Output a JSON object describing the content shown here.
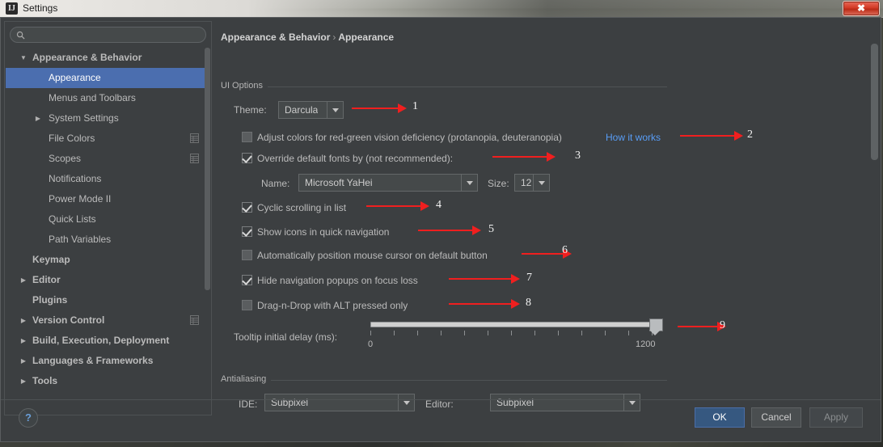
{
  "window": {
    "title": "Settings",
    "app_icon": "intellij-idea-icon",
    "close_label": "✖"
  },
  "sidebar": {
    "search": {
      "value": "",
      "placeholder": ""
    },
    "items": [
      {
        "label": "Appearance & Behavior",
        "level": 0,
        "arrow": "down",
        "selected": false,
        "gear": false
      },
      {
        "label": "Appearance",
        "level": 1,
        "arrow": "none",
        "selected": true,
        "gear": false
      },
      {
        "label": "Menus and Toolbars",
        "level": 1,
        "arrow": "none",
        "selected": false,
        "gear": false
      },
      {
        "label": "System Settings",
        "level": 1,
        "arrow": "right",
        "selected": false,
        "gear": false
      },
      {
        "label": "File Colors",
        "level": 1,
        "arrow": "none",
        "selected": false,
        "gear": true
      },
      {
        "label": "Scopes",
        "level": 1,
        "arrow": "none",
        "selected": false,
        "gear": true
      },
      {
        "label": "Notifications",
        "level": 1,
        "arrow": "none",
        "selected": false,
        "gear": false
      },
      {
        "label": "Power Mode II",
        "level": 1,
        "arrow": "none",
        "selected": false,
        "gear": false
      },
      {
        "label": "Quick Lists",
        "level": 1,
        "arrow": "none",
        "selected": false,
        "gear": false
      },
      {
        "label": "Path Variables",
        "level": 1,
        "arrow": "none",
        "selected": false,
        "gear": false
      },
      {
        "label": "Keymap",
        "level": 0,
        "arrow": "none",
        "selected": false,
        "gear": false
      },
      {
        "label": "Editor",
        "level": 0,
        "arrow": "right",
        "selected": false,
        "gear": false
      },
      {
        "label": "Plugins",
        "level": 0,
        "arrow": "none",
        "selected": false,
        "gear": false
      },
      {
        "label": "Version Control",
        "level": 0,
        "arrow": "right",
        "selected": false,
        "gear": true
      },
      {
        "label": "Build, Execution, Deployment",
        "level": 0,
        "arrow": "right",
        "selected": false,
        "gear": false
      },
      {
        "label": "Languages & Frameworks",
        "level": 0,
        "arrow": "right",
        "selected": false,
        "gear": false
      },
      {
        "label": "Tools",
        "level": 0,
        "arrow": "right",
        "selected": false,
        "gear": false
      }
    ]
  },
  "content": {
    "breadcrumb": {
      "root": "Appearance & Behavior",
      "separator": "›",
      "leaf": "Appearance"
    },
    "ui_options": {
      "title": "UI Options",
      "theme_label": "Theme:",
      "theme_value": "Darcula",
      "checkboxes": [
        {
          "label": "Adjust colors for red-green vision deficiency (protanopia, deuteranopia)",
          "checked": false,
          "link": "How it works"
        },
        {
          "label": "Override default fonts by (not recommended):",
          "checked": true
        },
        {
          "label": "Cyclic scrolling in list",
          "checked": true
        },
        {
          "label": "Show icons in quick navigation",
          "checked": true
        },
        {
          "label": "Automatically position mouse cursor on default button",
          "checked": false
        },
        {
          "label": "Hide navigation popups on focus loss",
          "checked": true
        },
        {
          "label": "Drag-n-Drop with ALT pressed only",
          "checked": false
        }
      ],
      "font_name_label": "Name:",
      "font_name_value": "Microsoft YaHei",
      "font_size_label": "Size:",
      "font_size_value": "12",
      "tooltip_delay_label": "Tooltip initial delay (ms):",
      "tooltip_min": "0",
      "tooltip_max": "1200",
      "tooltip_value": 1200
    },
    "antialiasing": {
      "title": "Antialiasing",
      "ide_label": "IDE:",
      "ide_value": "Subpixel",
      "editor_label": "Editor:",
      "editor_value": "Subpixel"
    }
  },
  "annotations": [
    {
      "number": "1"
    },
    {
      "number": "2"
    },
    {
      "number": "3"
    },
    {
      "number": "4"
    },
    {
      "number": "5"
    },
    {
      "number": "6"
    },
    {
      "number": "7"
    },
    {
      "number": "8"
    },
    {
      "number": "9"
    }
  ],
  "footer": {
    "help_label": "?",
    "ok_label": "OK",
    "cancel_label": "Cancel",
    "apply_label": "Apply"
  },
  "colors": {
    "panel_bg": "#3c3f41",
    "selection_blue": "#4b6eaf",
    "link_blue": "#589df6",
    "annotation_red": "#f01f1f",
    "ok_button": "#365880"
  }
}
